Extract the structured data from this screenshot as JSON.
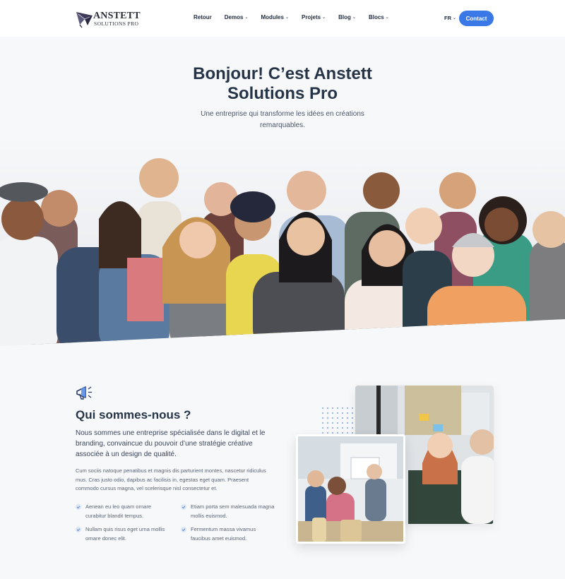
{
  "brand": {
    "name": "ANSTETT",
    "tagline": "SOLUTIONS PRO"
  },
  "nav": {
    "items": [
      {
        "label": "Retour",
        "dropdown": false
      },
      {
        "label": "Demos",
        "dropdown": true
      },
      {
        "label": "Modules",
        "dropdown": true
      },
      {
        "label": "Projets",
        "dropdown": true
      },
      {
        "label": "Blog",
        "dropdown": true
      },
      {
        "label": "Blocs",
        "dropdown": true
      }
    ],
    "language": "FR",
    "contact_label": "Contact"
  },
  "hero": {
    "title_line1": "Bonjour! C’est Anstett",
    "title_line2": "Solutions Pro",
    "subtitle": "Une entreprise qui transforme les idées en créations remarquables."
  },
  "about": {
    "title": "Qui sommes-nous ?",
    "lead": "Nous sommes une entreprise spécialisée dans le digital et le branding, convaincue du pouvoir d’une stratégie créative associée à un design de qualité.",
    "body": "Cum sociis natoque penatibus et magnis dis parturient montes, nascetur ridiculus mus. Cras justo odio, dapibus ac facilisis in, egestas eget quam. Praesent commodo cursus magna, vel scelerisque nisl consectetur et.",
    "features": [
      "Aenean eu leo quam ornare curabitur blandit tempus.",
      "Etiam porta sem malesuada magna mollis euismod.",
      "Nullam quis risus eget urna mollis ornare donec elit.",
      "Fermentum massa vivamus faucibus amet euismod."
    ]
  },
  "colors": {
    "accent": "#3b78e7",
    "heading": "#263448",
    "background": "#f7f8fa",
    "check": "#9db8d9"
  },
  "icons": {
    "logo": "bird-logo-icon",
    "chevron": "chevron-down-icon",
    "about": "megaphone-icon",
    "feature": "check-icon"
  }
}
